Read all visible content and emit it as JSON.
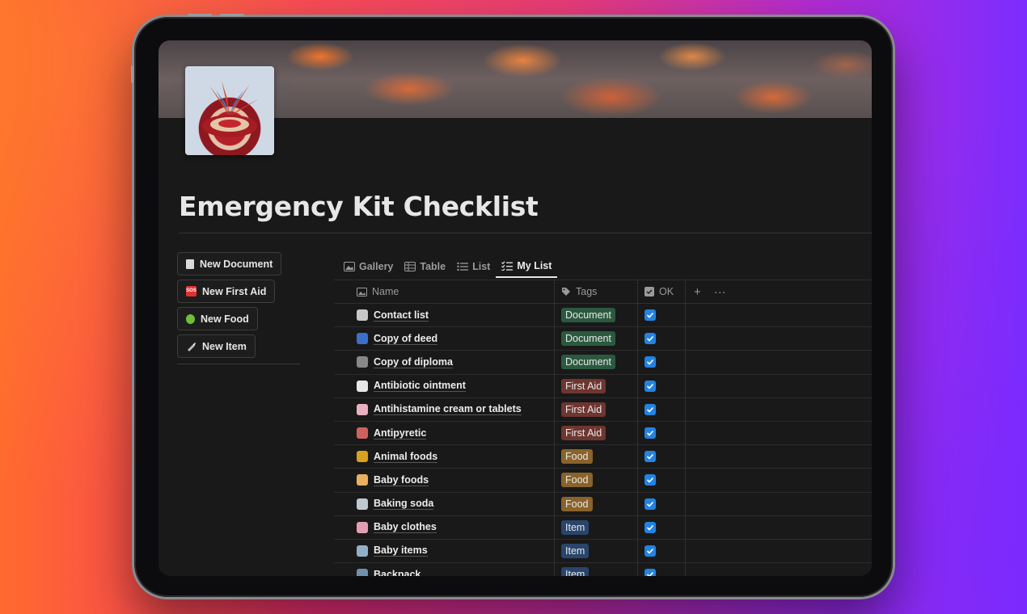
{
  "page": {
    "title": "Emergency Kit Checklist"
  },
  "sidebar": {
    "buttons": [
      {
        "label": "New Document",
        "icon": "document-icon",
        "color": "#d9d9d9"
      },
      {
        "label": "New First Aid",
        "icon": "sos-icon",
        "color": "#e03030"
      },
      {
        "label": "New Food",
        "icon": "apple-icon",
        "color": "#6fbf3a"
      },
      {
        "label": "New Item",
        "icon": "flashlight-icon",
        "color": "#cfcfcf"
      }
    ]
  },
  "views": {
    "tabs": [
      {
        "label": "Gallery",
        "icon": "gallery-icon",
        "active": false
      },
      {
        "label": "Table",
        "icon": "table-icon",
        "active": false
      },
      {
        "label": "List",
        "icon": "list-icon",
        "active": false
      },
      {
        "label": "My List",
        "icon": "checklist-icon",
        "active": true
      }
    ]
  },
  "table": {
    "columns": {
      "name": "Name",
      "tags": "Tags",
      "ok": "OK",
      "add": "+",
      "more": "···"
    },
    "rows": [
      {
        "name": "Contact list",
        "tag": "Document",
        "ok": true,
        "icon_color": "#c8c8c8"
      },
      {
        "name": "Copy of deed",
        "tag": "Document",
        "ok": true,
        "icon_color": "#3a70c8"
      },
      {
        "name": "Copy of diploma",
        "tag": "Document",
        "ok": true,
        "icon_color": "#888888"
      },
      {
        "name": "Antibiotic ointment",
        "tag": "First Aid",
        "ok": true,
        "icon_color": "#e8e8e8"
      },
      {
        "name": "Antihistamine cream or tablets",
        "tag": "First Aid",
        "ok": true,
        "icon_color": "#e8b0c0"
      },
      {
        "name": "Antipyretic",
        "tag": "First Aid",
        "ok": true,
        "icon_color": "#d06060"
      },
      {
        "name": "Animal foods",
        "tag": "Food",
        "ok": true,
        "icon_color": "#d8a020"
      },
      {
        "name": "Baby foods",
        "tag": "Food",
        "ok": true,
        "icon_color": "#e8b060"
      },
      {
        "name": "Baking soda",
        "tag": "Food",
        "ok": true,
        "icon_color": "#c0c8d0"
      },
      {
        "name": "Baby clothes",
        "tag": "Item",
        "ok": true,
        "icon_color": "#e0a0b0"
      },
      {
        "name": "Baby items",
        "tag": "Item",
        "ok": true,
        "icon_color": "#90b0c8"
      },
      {
        "name": "Backpack",
        "tag": "Item",
        "ok": true,
        "icon_color": "#7090b0"
      }
    ]
  },
  "colors": {
    "checkbox": "#2383e2",
    "tag_document": "#2b593f",
    "tag_first_aid": "#6e3630",
    "tag_food": "#89632a",
    "tag_item": "#28456c"
  }
}
